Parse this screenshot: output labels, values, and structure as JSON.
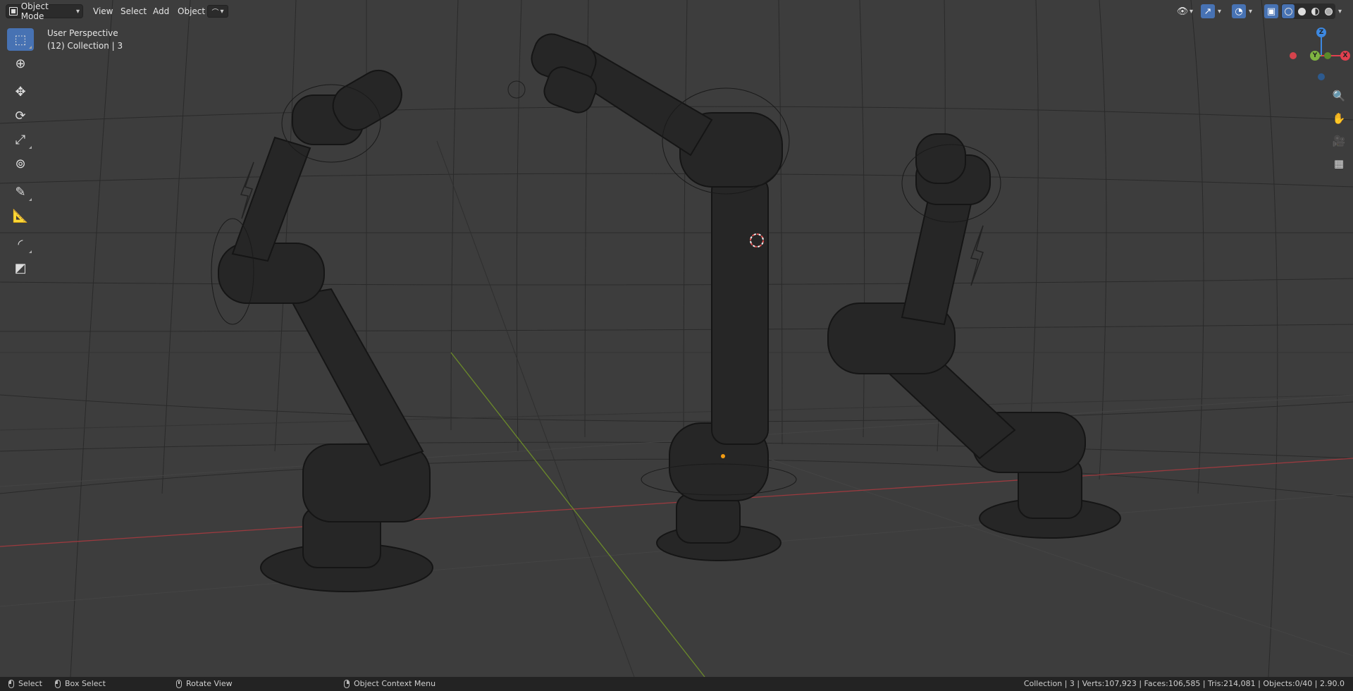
{
  "header": {
    "mode": "Object Mode",
    "menus": [
      "View",
      "Select",
      "Add",
      "Object"
    ]
  },
  "view_info": {
    "perspective": "User Perspective",
    "collection": "(12) Collection | 3"
  },
  "toolbar": {
    "tools": [
      "select-box",
      "cursor",
      "move",
      "rotate",
      "scale",
      "transform",
      "annotate",
      "measure",
      "add-shape",
      "add-plane"
    ]
  },
  "gizmo": {
    "z": "Z",
    "y": "Y",
    "x": "X"
  },
  "statusbar": {
    "select": "Select",
    "box_select": "Box Select",
    "rotate_view": "Rotate View",
    "context_menu": "Object Context Menu",
    "stats": "Collection | 3 | Verts:107,923 | Faces:106,585 | Tris:214,081 | Objects:0/40 | 2.90.0"
  },
  "colors": {
    "viewport_bg": "#3d3d3d",
    "accent": "#4772b3",
    "x_axis": "#e0404f",
    "y_axis": "#7fb341",
    "z_axis": "#3d88e0"
  }
}
